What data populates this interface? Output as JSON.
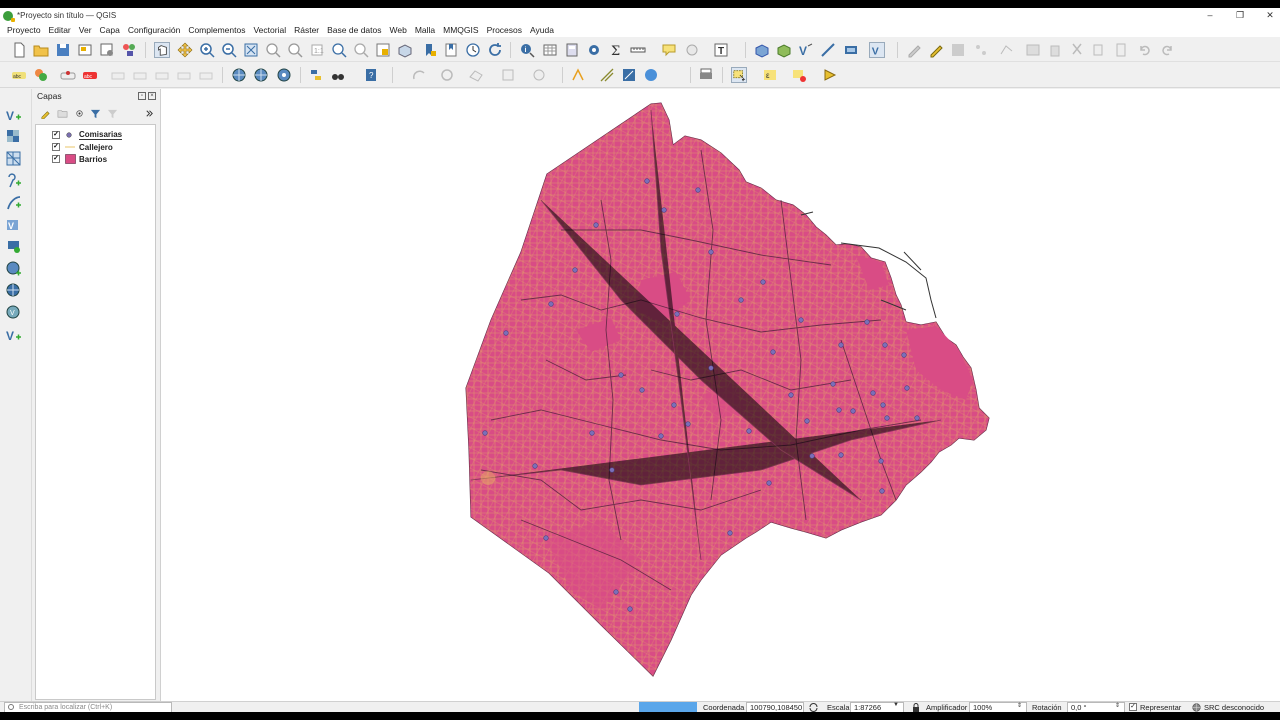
{
  "window": {
    "title": "*Proyecto sin título — QGIS",
    "minimize": "–",
    "maximize": "❐",
    "close": "✕"
  },
  "menu": [
    "Proyecto",
    "Editar",
    "Ver",
    "Capa",
    "Configuración",
    "Complementos",
    "Vectorial",
    "Ráster",
    "Base de datos",
    "Web",
    "Malla",
    "MMQGIS",
    "Procesos",
    "Ayuda"
  ],
  "layers_panel": {
    "title": "Capas",
    "layers": [
      {
        "name": "Comisarias",
        "checked": "✓",
        "symbol": "point",
        "color": "#7a6fb0"
      },
      {
        "name": "Callejero",
        "checked": "✓",
        "symbol": "line",
        "color": "#e8c46a"
      },
      {
        "name": "Barrios",
        "checked": "✓",
        "symbol": "polygon",
        "color": "#d94c85"
      }
    ]
  },
  "colors": {
    "barrios_fill": "#d94c85",
    "callejero": "#e8b960",
    "comisarias": "#7b6fb8",
    "boundary": "#5a2540"
  },
  "status": {
    "locator_placeholder": "Escriba para localizar (Ctrl+K)",
    "coord_label": "Coordenada",
    "coord_value": "100790,108450",
    "scale_label": "Escala",
    "scale_value": "1:87266",
    "magnifier_label": "Amplificador",
    "magnifier_value": "100%",
    "rotation_label": "Rotación",
    "rotation_value": "0,0 °",
    "render_label": "Representar",
    "render_checked": "✓",
    "crs_label": "SRC desconocido"
  }
}
